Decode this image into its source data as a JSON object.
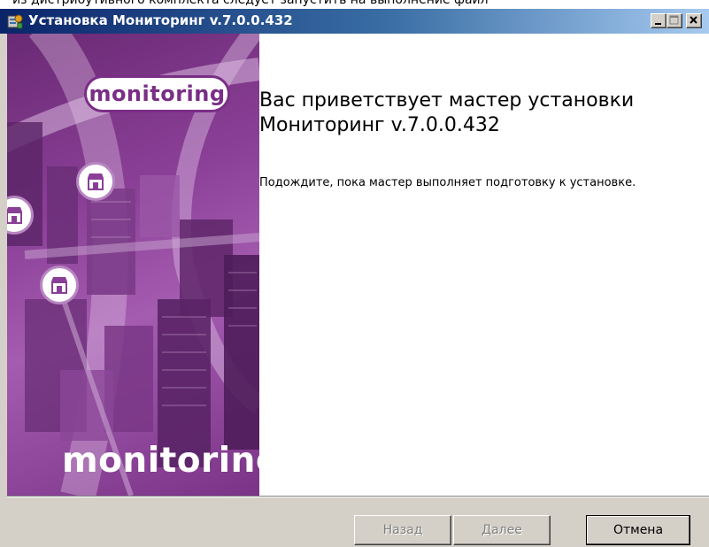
{
  "top_snippet": "из дистрибутивного комплекта следует запустить на выполнение файл",
  "window": {
    "title": "Установка Мониторинг v.7.0.0.432",
    "accent": "#0a246a"
  },
  "banner": {
    "logo_top": "monitoring",
    "logo_bottom": "monitoring",
    "color": "#8a3f96"
  },
  "content": {
    "title_line1": "Вас приветствует мастер установки",
    "title_line2": "Мониторинг v.7.0.0.432",
    "body": "Подождите, пока мастер выполняет подготовку к установке."
  },
  "buttons": {
    "back": "Назад",
    "next": "Далее",
    "cancel": "Отмена"
  },
  "icons": {
    "title": "installer-icon",
    "minimize": "minimize-icon",
    "maximize": "maximize-icon",
    "close": "close-icon",
    "store": "store-icon"
  }
}
